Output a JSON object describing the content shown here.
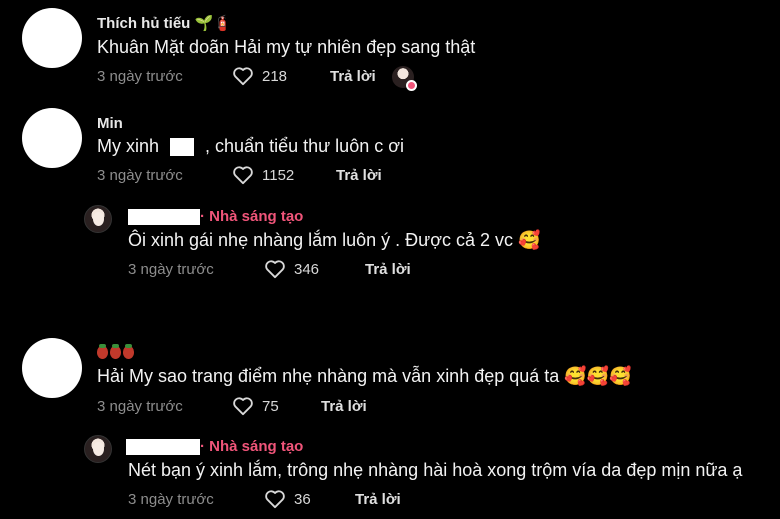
{
  "comments": [
    {
      "author": "Thích hủ tiếu 🌱🧯",
      "text": "Khuân Mặt doãn Hải my tự nhiên đẹp sang thật",
      "time": "3 ngày trước",
      "likes": "218",
      "reply_label": "Trả lời"
    },
    {
      "author": "Min",
      "text_before": "My xinh",
      "text_after": ", chuẩn tiểu thư luôn c ơi",
      "time": "3 ngày trước",
      "likes": "1152",
      "reply_label": "Trả lời",
      "reply": {
        "creator_label": "· Nhà sáng tạo",
        "text": "Ôi xinh gái nhẹ nhàng lắm luôn ý . Được cả 2 vc 🥰",
        "time": "3 ngày trước",
        "likes": "346",
        "reply_label": "Trả lời"
      }
    },
    {
      "author_emoji": "🍓🍓🍓",
      "text": "Hải My sao trang điểm nhẹ nhàng mà vẫn xinh đẹp quá ta 🥰🥰🥰",
      "time": "3 ngày trước",
      "likes": "75",
      "reply_label": "Trả lời",
      "reply": {
        "creator_label": "· Nhà sáng tạo",
        "text": "Nét bạn ý xinh lắm, trông nhẹ nhàng hài hoà xong trộm vía da đẹp mịn nữa ạ",
        "time": "3 ngày trước",
        "likes": "36",
        "reply_label": "Trả lời"
      }
    }
  ],
  "icons": {
    "heart": "heart-outline-icon",
    "creator_liked": "creator-liked-badge-icon"
  },
  "colors": {
    "background": "#000000",
    "creator_accent": "#f0557a",
    "meta_gray": "#8d8d8d"
  }
}
